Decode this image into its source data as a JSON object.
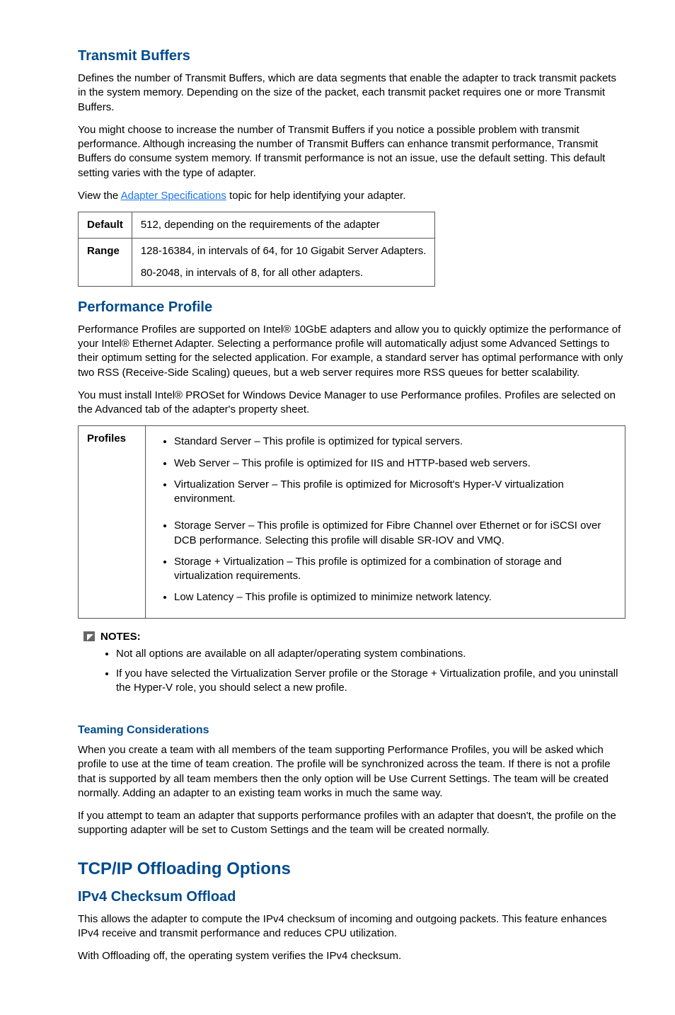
{
  "s1": {
    "title": "Transmit Buffers",
    "p1": "Defines the number of Transmit Buffers, which are data segments that enable the adapter to track transmit packets in the system memory. Depending on the size of the packet, each transmit packet requires one or more Transmit Buffers.",
    "p2": "You might choose to increase the number of Transmit Buffers if you notice a possible problem with transmit performance. Although increasing the number of Transmit Buffers can enhance transmit performance, Transmit Buffers do consume system memory. If transmit performance is not an issue, use the default setting. This default setting varies with the type of adapter.",
    "p3a": "View the ",
    "p3link": "Adapter Specifications",
    "p3b": " topic for help identifying your adapter.",
    "table": {
      "r1": {
        "label": "Default",
        "value": "512, depending on the requirements of the adapter"
      },
      "r2": {
        "label": "Range",
        "line1": "128-16384, in intervals of 64, for 10 Gigabit Server Adapters.",
        "line2": "80-2048, in intervals of 8, for all other adapters."
      }
    }
  },
  "s2": {
    "title": "Performance Profile",
    "p1": "Performance Profiles are supported on Intel® 10GbE adapters and allow you to quickly optimize the performance of your Intel® Ethernet Adapter. Selecting a performance profile will automatically adjust some Advanced Settings to their optimum setting for the selected application. For example, a standard server has optimal performance with only two RSS (Receive-Side Scaling) queues, but a web server requires more RSS queues for better scalability.",
    "p2": "You must install Intel® PROSet for Windows Device Manager to use Performance profiles. Profiles are selected on the Advanced tab of the adapter's property sheet.",
    "table": {
      "label": "Profiles",
      "items": [
        "Standard Server – This profile is optimized for typical servers.",
        "Web Server – This profile is optimized for IIS and HTTP-based web servers.",
        "Virtualization Server – This profile is optimized for Microsoft's Hyper-V virtualization environment.",
        "Storage Server – This profile is optimized for Fibre Channel over Ethernet or for iSCSI over DCB performance. Selecting this profile will disable SR-IOV and VMQ.",
        "Storage + Virtualization – This profile is optimized for a combination of storage and virtualization requirements.",
        "Low Latency – This profile is optimized to minimize network latency."
      ]
    },
    "notes": {
      "title": "NOTES:",
      "items": [
        "Not all options are available on all adapter/operating system combinations.",
        "If you have selected the Virtualization Server profile or the Storage + Virtualization profile, and you uninstall the Hyper-V role, you should select a new profile."
      ]
    }
  },
  "s3": {
    "title": "Teaming Considerations",
    "p1": "When you create a team with all members of the team supporting Performance Profiles, you will be asked which profile to use at the time of team creation. The profile will be synchronized across the team. If there is not a profile that is supported by all team members then the only option will be Use Current Settings. The team will be created normally. Adding an adapter to an existing team works in much the same way.",
    "p2": "If you attempt to team an adapter that supports performance profiles with an adapter that doesn't, the profile on the supporting adapter will be set to Custom Settings and the team will be created normally."
  },
  "s4": {
    "title": "TCP/IP Offloading Options"
  },
  "s5": {
    "title": "IPv4 Checksum Offload",
    "p1": "This allows the adapter to compute the IPv4 checksum of incoming and outgoing packets. This feature enhances IPv4 receive and transmit performance and reduces CPU utilization.",
    "p2": "With Offloading off, the operating system verifies the IPv4 checksum."
  }
}
